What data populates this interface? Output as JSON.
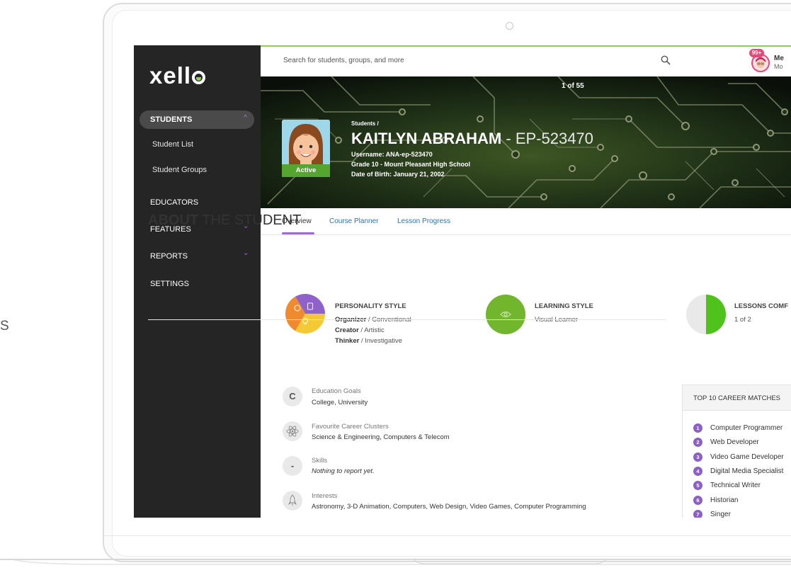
{
  "side_letter": "S",
  "sidebar": {
    "logo_text": "xell",
    "students_label": "STUDENTS",
    "student_list": "Student List",
    "student_groups": "Student Groups",
    "educators": "EDUCATORS",
    "features": "FEATURES",
    "reports": "REPORTS",
    "settings": "SETTINGS",
    "chevron_up": "^",
    "chevron_down": "⌄"
  },
  "topbar": {
    "search_placeholder": "Search for students, groups, and more",
    "notification_count": "99+",
    "user_name": "Me",
    "user_sub": "Mo"
  },
  "banner": {
    "pager": "1 of 55",
    "breadcrumb": "Students /",
    "student_name": "KAITLYN ABRAHAM",
    "student_id": " - EP-523470",
    "username": "Username: ANA-ep-523470",
    "grade": "Grade 10 - Mount Pleasant High School",
    "dob": "Date of Birth: January 21, 2002",
    "status": "Active"
  },
  "tabs": {
    "overview": "Overview",
    "course_planner": "Course Planner",
    "lesson_progress": "Lesson Progress"
  },
  "about": {
    "title_bold": "ABOUT",
    "title_rest": " THE STUDENT",
    "personality": {
      "title": "PERSONALITY STYLE",
      "lines": [
        {
          "bold": "Organizer",
          "rest": " / Conventional"
        },
        {
          "bold": "Creator",
          "rest": " / Artistic"
        },
        {
          "bold": "Thinker",
          "rest": " / Investigative"
        }
      ],
      "colors": [
        "#8e62c8",
        "#f5c935",
        "#f08a2e"
      ]
    },
    "learning": {
      "title": "LEARNING STYLE",
      "value": "Visual Learner",
      "color": "#71b62d"
    },
    "lessons": {
      "title": "LESSONS COMF",
      "value": "1 of 2",
      "completed_fraction": 0.5,
      "color": "#4fc21c"
    }
  },
  "info": {
    "education_goals": {
      "label": "Education Goals",
      "value": "College, University",
      "icon_letter": "C"
    },
    "career_clusters": {
      "label": "Favourite Career Clusters",
      "value": "Science & Engineering, Computers & Telecom"
    },
    "skills": {
      "label": "Skills",
      "value": "Nothing to report yet.",
      "icon_letter": "-"
    },
    "interests": {
      "label": "Interests",
      "value": "Astronomy, 3-D Animation, Computers, Web Design, Video Games, Computer Programming"
    }
  },
  "careers": {
    "title": "TOP 10 CAREER MATCHES",
    "items": [
      {
        "rank": "1",
        "name": "Computer Programmer"
      },
      {
        "rank": "2",
        "name": "Web Developer"
      },
      {
        "rank": "3",
        "name": "Video Game Developer"
      },
      {
        "rank": "4",
        "name": "Digital Media Specialist"
      },
      {
        "rank": "5",
        "name": "Technical Writer"
      },
      {
        "rank": "6",
        "name": "Historian"
      },
      {
        "rank": "7",
        "name": "Singer"
      }
    ]
  },
  "colors": {
    "accent_purple": "#8d5fc9",
    "accent_green": "#8cd04b",
    "sidebar_bg": "#252525",
    "link_blue": "#2f73a8"
  }
}
